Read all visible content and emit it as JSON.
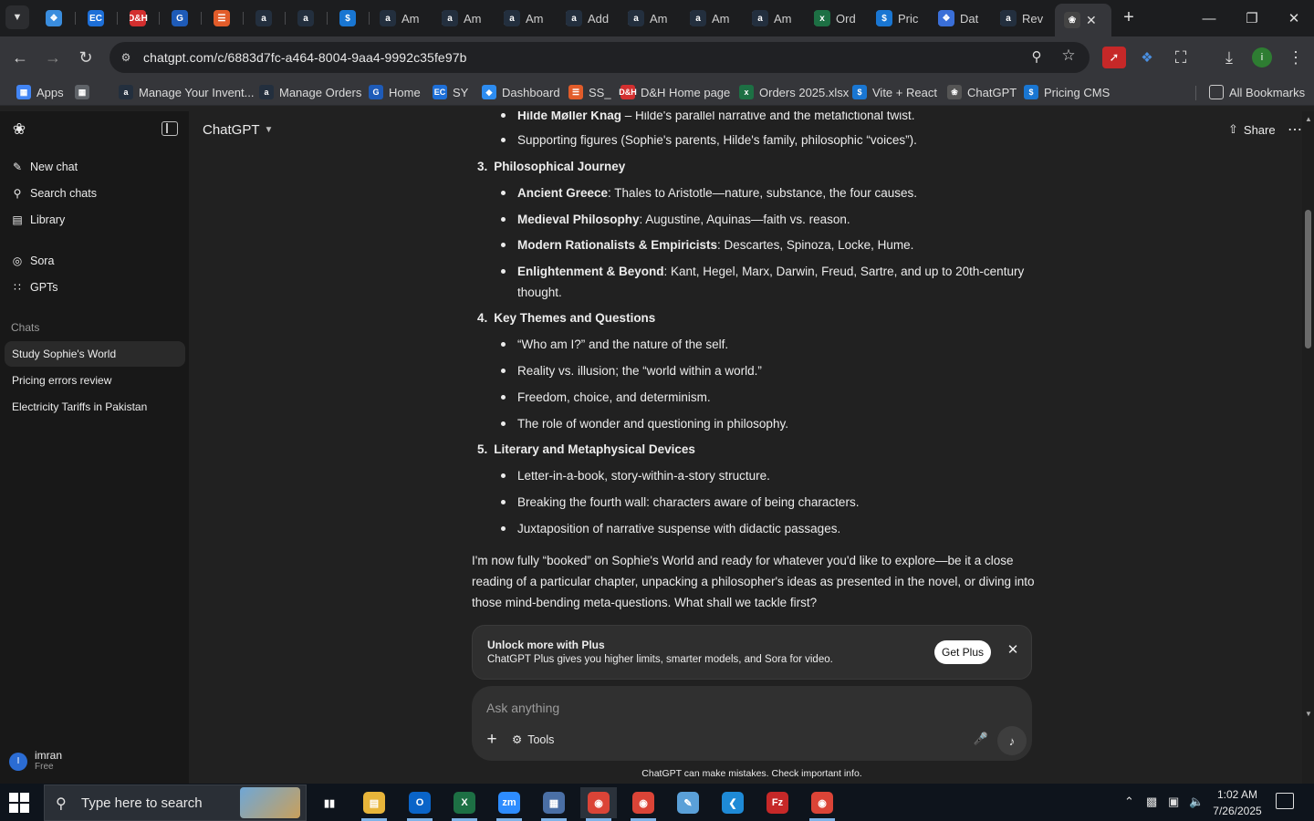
{
  "browser": {
    "tabs": [
      {
        "label": "",
        "icon": "link-icon",
        "color": "#3a8dde"
      },
      {
        "label": "",
        "icon": "ec-icon",
        "color": "#1d6fd8"
      },
      {
        "label": "",
        "icon": "dh-icon",
        "color": "#d32f2f"
      },
      {
        "label": "",
        "icon": "g-icon",
        "color": "#1e5bb8"
      },
      {
        "label": "",
        "icon": "stack-icon",
        "color": "#e25c2a"
      },
      {
        "label": "",
        "icon": "amazon-icon",
        "color": "#232f3e"
      },
      {
        "label": "",
        "icon": "amazon-icon",
        "color": "#232f3e"
      },
      {
        "label": "",
        "icon": "dollar-icon",
        "color": "#1976d2"
      },
      {
        "label": "Am",
        "icon": "amazon-icon",
        "color": "#232f3e"
      },
      {
        "label": "Am",
        "icon": "amazon-icon",
        "color": "#232f3e"
      },
      {
        "label": "Am",
        "icon": "amazon-icon",
        "color": "#232f3e"
      },
      {
        "label": "Add",
        "icon": "amazon-icon",
        "color": "#232f3e"
      },
      {
        "label": "Am",
        "icon": "amazon-icon",
        "color": "#232f3e"
      },
      {
        "label": "Am",
        "icon": "amazon-icon",
        "color": "#232f3e"
      },
      {
        "label": "Am",
        "icon": "amazon-icon",
        "color": "#232f3e"
      },
      {
        "label": "Ord",
        "icon": "excel-icon",
        "color": "#1d7044"
      },
      {
        "label": "Pric",
        "icon": "dollar-icon",
        "color": "#1976d2"
      },
      {
        "label": "Dat",
        "icon": "puzzle-icon",
        "color": "#3a6fd8"
      },
      {
        "label": "Rev",
        "icon": "amazon-icon",
        "color": "#232f3e"
      }
    ],
    "url": "chatgpt.com/c/6883d7fc-a464-8004-9aa4-9992c35fe97b",
    "bookmarks": [
      {
        "label": "Apps",
        "icon": "apps-icon",
        "color": "#4285f4"
      },
      {
        "label": "",
        "icon": "grid-icon",
        "color": "#5f6368"
      },
      {
        "label": "Manage Your Invent...",
        "icon": "amazon-icon",
        "color": "#232f3e"
      },
      {
        "label": "Manage Orders",
        "icon": "amazon-icon",
        "color": "#232f3e"
      },
      {
        "label": "Home",
        "icon": "g-icon",
        "color": "#1e5bb8"
      },
      {
        "label": "SY",
        "icon": "ec-icon",
        "color": "#1d6fd8"
      },
      {
        "label": "Dashboard",
        "icon": "dashboard-icon",
        "color": "#2d8cf0"
      },
      {
        "label": "SS_",
        "icon": "stack-icon",
        "color": "#e25c2a"
      },
      {
        "label": "D&H Home page",
        "icon": "dh-icon",
        "color": "#d32f2f"
      },
      {
        "label": "Orders 2025.xlsx",
        "icon": "excel-icon",
        "color": "#1d7044"
      },
      {
        "label": "Vite + React",
        "icon": "dollar-icon",
        "color": "#1976d2"
      },
      {
        "label": "ChatGPT",
        "icon": "openai-icon",
        "color": "#555555"
      },
      {
        "label": "Pricing CMS",
        "icon": "dollar-icon",
        "color": "#1976d2"
      }
    ],
    "all_bookmarks": "All Bookmarks"
  },
  "sidebar": {
    "nav": [
      {
        "label": "New chat",
        "icon": "pencil-icon"
      },
      {
        "label": "Search chats",
        "icon": "search-icon"
      },
      {
        "label": "Library",
        "icon": "library-icon"
      },
      {
        "label": "Sora",
        "icon": "sora-icon"
      },
      {
        "label": "GPTs",
        "icon": "gpts-icon"
      }
    ],
    "section_title": "Chats",
    "chats": [
      {
        "label": "Study Sophie's World",
        "active": true
      },
      {
        "label": "Pricing errors review",
        "active": false
      },
      {
        "label": "Electricity Tariffs in Pakistan",
        "active": false
      }
    ],
    "user": {
      "initial": "I",
      "name": "imran",
      "plan": "Free"
    }
  },
  "header": {
    "model": "ChatGPT",
    "share": "Share"
  },
  "message": {
    "top_bullets": [
      {
        "bold": "Hilde Møller Knag",
        "text": " – Hilde's parallel narrative and the metafictional twist."
      },
      {
        "bold": "",
        "text": "Supporting figures (Sophie's parents, Hilde's family, philosophic “voices”)."
      }
    ],
    "sections": [
      {
        "num": "3.",
        "title": "Philosophical Journey",
        "items": [
          {
            "bold": "Ancient Greece",
            "text": ": Thales to Aristotle—nature, substance, the four causes."
          },
          {
            "bold": "Medieval Philosophy",
            "text": ": Augustine, Aquinas—faith vs. reason."
          },
          {
            "bold": "Modern Rationalists & Empiricists",
            "text": ": Descartes, Spinoza, Locke, Hume."
          },
          {
            "bold": "Enlightenment & Beyond",
            "text": ": Kant, Hegel, Marx, Darwin, Freud, Sartre, and up to 20th-century thought."
          }
        ]
      },
      {
        "num": "4.",
        "title": "Key Themes and Questions",
        "items": [
          {
            "bold": "",
            "text": "“Who am I?” and the nature of the self."
          },
          {
            "bold": "",
            "text": "Reality vs. illusion; the “world within a world.”"
          },
          {
            "bold": "",
            "text": "Freedom, choice, and determinism."
          },
          {
            "bold": "",
            "text": "The role of wonder and questioning in philosophy."
          }
        ]
      },
      {
        "num": "5.",
        "title": "Literary and Metaphysical Devices",
        "items": [
          {
            "bold": "",
            "text": "Letter-in-a-book, story-within-a-story structure."
          },
          {
            "bold": "",
            "text": "Breaking the fourth wall: characters aware of being characters."
          },
          {
            "bold": "",
            "text": "Juxtaposition of narrative suspense with didactic passages."
          }
        ]
      }
    ],
    "closing": "I'm now fully “booked” on Sophie's World and ready for whatever you'd like to explore—be it a close reading of a particular chapter, unpacking a philosopher's ideas as presented in the novel, or diving into those mind-bending meta-questions. What shall we tackle first?"
  },
  "upsell": {
    "title": "Unlock more with Plus",
    "desc": "ChatGPT Plus gives you higher limits, smarter models, and Sora for video.",
    "button": "Get Plus"
  },
  "composer": {
    "placeholder": "Ask anything",
    "tools": "Tools"
  },
  "disclaimer": "ChatGPT can make mistakes. Check important info.",
  "taskbar": {
    "search_placeholder": "Type here to search",
    "time": "1:02 AM",
    "date": "7/26/2025",
    "apps": [
      {
        "name": "task-view",
        "color": "#0e141c"
      },
      {
        "name": "file-explorer",
        "color": "#e8b53a"
      },
      {
        "name": "outlook",
        "color": "#0a64c8"
      },
      {
        "name": "excel",
        "color": "#1d7044"
      },
      {
        "name": "zoom",
        "color": "#2d8cff"
      },
      {
        "name": "calculator",
        "color": "#4a6fa5"
      },
      {
        "name": "chrome",
        "color": "#db4437"
      },
      {
        "name": "chrome",
        "color": "#db4437"
      },
      {
        "name": "notepad",
        "color": "#5aa0d8"
      },
      {
        "name": "vscode",
        "color": "#1e8ad6"
      },
      {
        "name": "filezilla",
        "color": "#c62828"
      },
      {
        "name": "chrome-profile",
        "color": "#db4437"
      }
    ]
  }
}
